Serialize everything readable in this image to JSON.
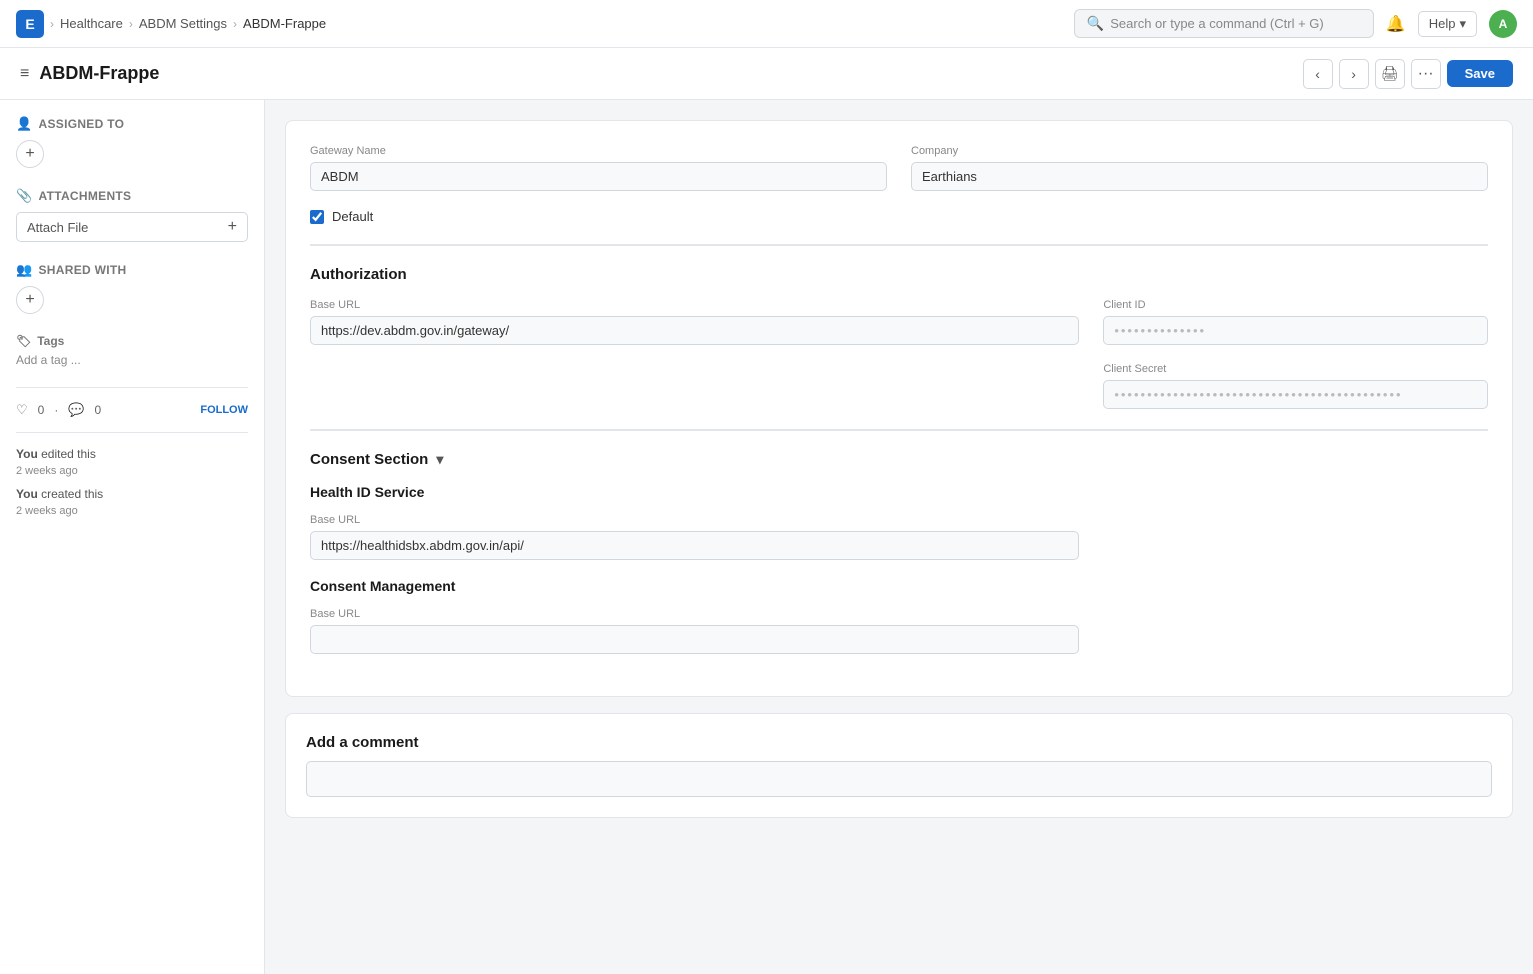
{
  "app": {
    "logo_letter": "E",
    "breadcrumbs": [
      {
        "label": "Healthcare",
        "active": false
      },
      {
        "label": "ABDM Settings",
        "active": false
      },
      {
        "label": "ABDM-Frappe",
        "active": true
      }
    ],
    "search_placeholder": "Search or type a command (Ctrl + G)",
    "help_label": "Help",
    "avatar_letter": "A",
    "page_title": "ABDM-Frappe",
    "save_label": "Save"
  },
  "sidebar": {
    "assigned_to_label": "Assigned To",
    "attachments_label": "Attachments",
    "attach_file_label": "Attach File",
    "shared_with_label": "Shared With",
    "tags_label": "Tags",
    "add_tag_label": "Add a tag ...",
    "likes_count": "0",
    "comments_count": "0",
    "follow_label": "FOLLOW",
    "activity_1_user": "You",
    "activity_1_action": "edited this",
    "activity_1_time": "2 weeks ago",
    "activity_2_user": "You",
    "activity_2_action": "created this",
    "activity_2_time": "2 weeks ago"
  },
  "form": {
    "gateway_name_label": "Gateway Name",
    "gateway_name_value": "ABDM",
    "company_label": "Company",
    "company_value": "Earthians",
    "default_label": "Default",
    "default_checked": true,
    "authorization_heading": "Authorization",
    "base_url_label": "Base URL",
    "base_url_value": "https://dev.abdm.gov.in/gateway/",
    "client_id_label": "Client ID",
    "client_id_value": "••••••••••••••",
    "client_secret_label": "Client Secret",
    "client_secret_value": "••••••••••••••••••••••••••••••••••••••••••••",
    "consent_section_label": "Consent Section",
    "health_id_service_heading": "Health ID Service",
    "health_id_base_url_label": "Base URL",
    "health_id_base_url_value": "https://healthidsbx.abdm.gov.in/api/",
    "consent_management_heading": "Consent Management",
    "consent_mgmt_base_url_label": "Base URL",
    "consent_mgmt_base_url_value": "",
    "add_comment_label": "Add a comment"
  }
}
